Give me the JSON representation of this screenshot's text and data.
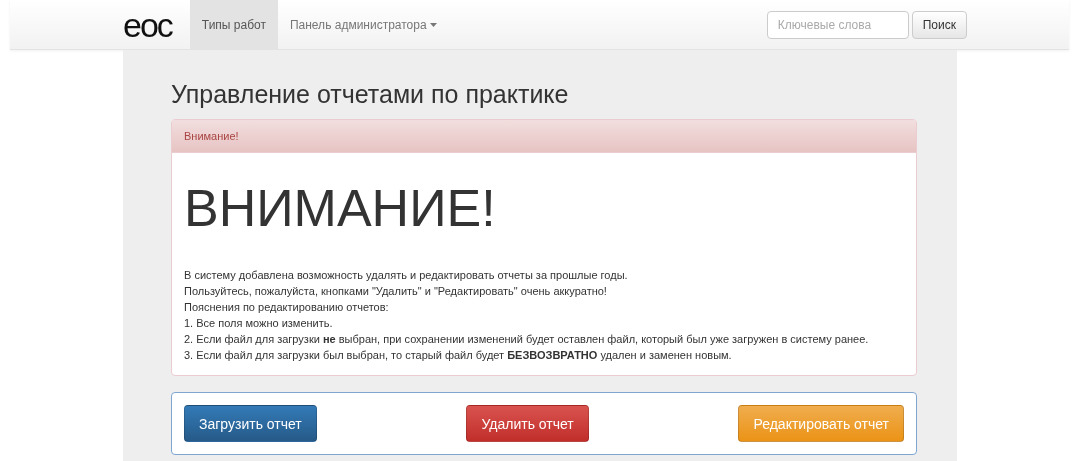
{
  "navbar": {
    "logo": "eoc",
    "items": [
      {
        "label": "Типы работ",
        "selected": true,
        "dropdown": false
      },
      {
        "label": "Панель администратора",
        "selected": false,
        "dropdown": true
      }
    ],
    "search": {
      "placeholder": "Ключевые слова",
      "button": "Поиск"
    }
  },
  "page_title": "Управление отчетами по практике",
  "alert": {
    "heading": "Внимание!",
    "title": "ВНИМАНИЕ!",
    "lines": [
      "В систему добавлена возможность удалять и редактировать отчеты за прошлые годы.",
      "Пользуйтесь, пожалуйста, кнопками \"Удалить\" и \"Редактировать\" очень аккуратно!",
      "Пояснения по редактированию отчетов:",
      "1. Все поля можно изменить.",
      "2. Если файл для загрузки **не** выбран, при сохранении изменений будет оставлен файл, который был уже загружен в систему ранее.",
      "3. Если файл для загрузки был выбран, то старый файл будет **БЕЗВОЗВРАТНО** удален и заменен новым."
    ]
  },
  "actions": [
    {
      "label": "Загрузить отчет",
      "kind": "primary"
    },
    {
      "label": "Удалить отчет",
      "kind": "danger"
    },
    {
      "label": "Редактировать отчет",
      "kind": "warning"
    }
  ]
}
